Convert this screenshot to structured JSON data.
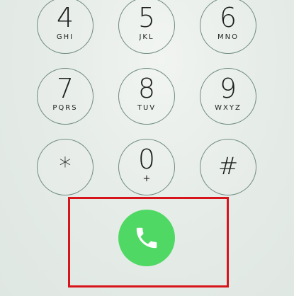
{
  "keypad": {
    "keys": [
      {
        "digit": "4",
        "letters": "GHI"
      },
      {
        "digit": "5",
        "letters": "JKL"
      },
      {
        "digit": "6",
        "letters": "MNO"
      },
      {
        "digit": "7",
        "letters": "PQRS"
      },
      {
        "digit": "8",
        "letters": "TUV"
      },
      {
        "digit": "9",
        "letters": "WXYZ"
      },
      {
        "symbol": "*"
      },
      {
        "digit": "0",
        "sub": "+"
      },
      {
        "symbol": "#"
      }
    ]
  },
  "call": {
    "icon": "phone-icon",
    "color": "#4fd964",
    "highlight_color": "#d8141b"
  }
}
